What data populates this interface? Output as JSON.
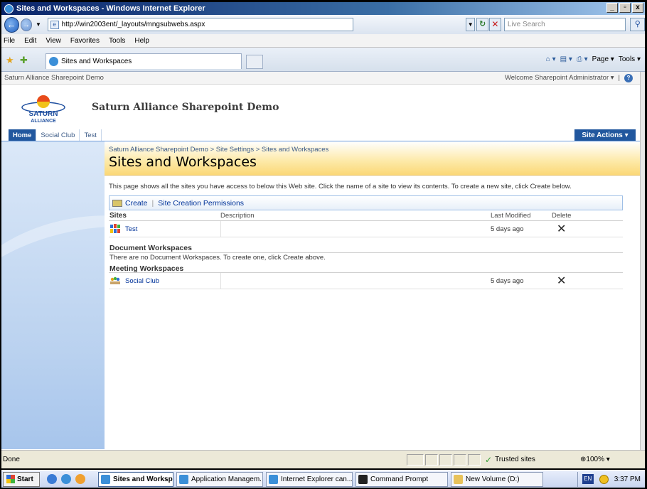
{
  "window": {
    "title": "Sites and Workspaces - Windows Internet Explorer",
    "btn_min": "_",
    "btn_max": "▫",
    "btn_close": "x"
  },
  "addressbar": {
    "url": "http://win2003ent/_layouts/mngsubwebs.aspx",
    "search_placeholder": "Live Search"
  },
  "menubar": {
    "items": [
      "File",
      "Edit",
      "View",
      "Favorites",
      "Tools",
      "Help"
    ]
  },
  "tabs": {
    "active_label": "Sites and Workspaces"
  },
  "commandbar": {
    "page_label": "Page",
    "tools_label": "Tools"
  },
  "sharepoint": {
    "top_site_name": "Saturn Alliance Sharepoint Demo",
    "welcome": "Welcome Sharepoint Administrator",
    "site_title": "Saturn Alliance Sharepoint Demo",
    "logo_text_top": "SATURN",
    "logo_text_bottom": "ALLIANCE",
    "nav": [
      "Home",
      "Social Club",
      "Test"
    ],
    "site_actions": "Site Actions",
    "breadcrumb": "Saturn Alliance Sharepoint Demo > Site Settings > Sites and Workspaces",
    "page_title": "Sites and Workspaces",
    "description": "This page shows all the sites you have access to below this Web site. Click the name of a site to view its contents. To create a new site, click Create below.",
    "toolbar": {
      "create": "Create",
      "separator": "|",
      "permissions": "Site Creation Permissions"
    },
    "columns": {
      "sites": "Sites",
      "description": "Description",
      "last_modified": "Last Modified",
      "delete": "Delete"
    },
    "sites": [
      {
        "name": "Test",
        "modified": "5 days ago",
        "delete": "✕"
      }
    ],
    "doc_workspaces": {
      "heading": "Document Workspaces",
      "empty_msg": "There are no Document Workspaces. To create one, click Create above."
    },
    "meeting_workspaces": {
      "heading": "Meeting Workspaces",
      "items": [
        {
          "name": "Social Club",
          "modified": "5 days ago",
          "delete": "✕"
        }
      ]
    }
  },
  "statusbar": {
    "status": "Done",
    "zone": "Trusted sites",
    "zoom": "100%"
  },
  "taskbar": {
    "start": "Start",
    "tasks": [
      "Sites and Workspa...",
      "Application Managem...",
      "Internet Explorer can...",
      "Command Prompt",
      "New Volume (D:)"
    ],
    "lang": "EN",
    "clock": "3:37 PM"
  }
}
